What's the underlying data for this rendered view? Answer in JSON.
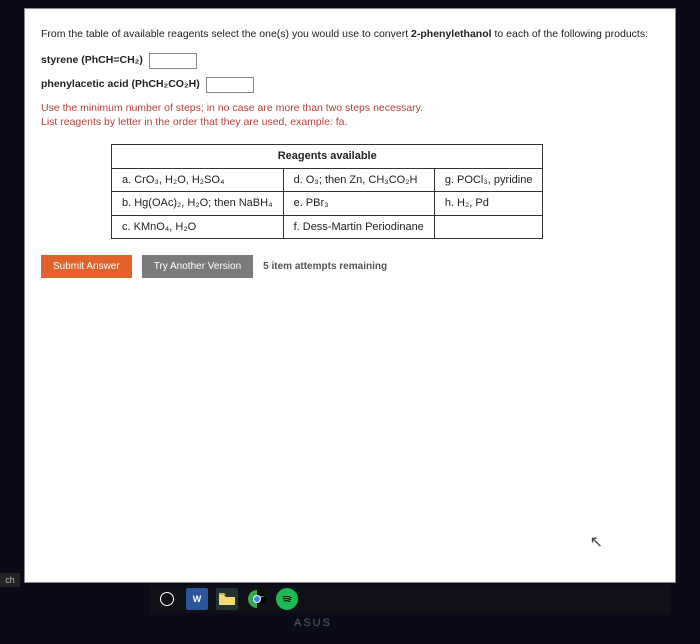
{
  "prompt": {
    "pre": "From the table of available reagents select the one(s) you would use to convert ",
    "bold": "2-phenylethanol",
    "post": " to each of the following products:"
  },
  "product1": {
    "label": "styrene (PhCH=CH₂)"
  },
  "product2": {
    "label": "phenylacetic acid (PhCH₂CO₂H)"
  },
  "instructions": {
    "line1": "Use the minimum number of steps; in no case are more than two steps necessary.",
    "line2": "List reagents by letter in the order that they are used, example: fa."
  },
  "table": {
    "header": "Reagents available",
    "a": "a. CrO₃, H₂O, H₂SO₄",
    "b": "b. Hg(OAc)₂, H₂O; then NaBH₄",
    "c": "c. KMnO₄, H₂O",
    "d": "d. O₃; then Zn, CH₃CO₂H",
    "e": "e. PBr₃",
    "f": "f. Dess-Martin Periodinane",
    "g": "g. POCl₃, pyridine",
    "h": "h. H₂, Pd"
  },
  "buttons": {
    "submit": "Submit Answer",
    "another": "Try Another Version",
    "attempts": "5 item attempts remaining"
  },
  "sidebar": {
    "label": "ch"
  },
  "taskbar": {
    "word": "W"
  },
  "brand": "ASUS"
}
